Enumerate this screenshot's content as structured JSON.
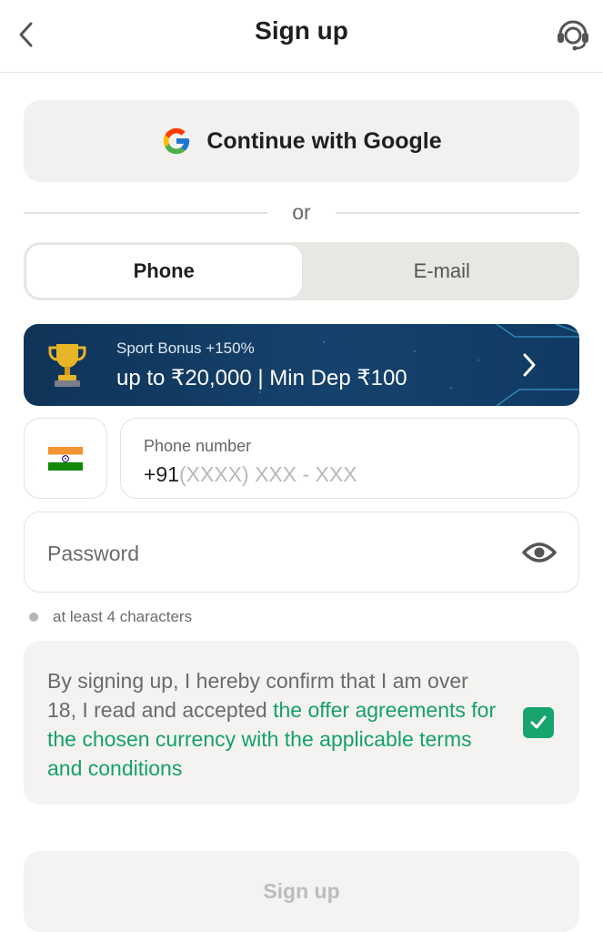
{
  "header": {
    "title": "Sign up",
    "back_icon": "chevron-left-icon",
    "support_icon": "headset-support-icon"
  },
  "google": {
    "label": "Continue with Google",
    "icon": "google-logo-icon"
  },
  "divider": {
    "text": "or"
  },
  "tabs": [
    {
      "label": "Phone",
      "active": true
    },
    {
      "label": "E-mail",
      "active": false
    }
  ],
  "bonus": {
    "title": "Sport Bonus +150%",
    "subtitle": "up to ₹20,000 | Min Dep ₹100",
    "icon": "trophy-icon",
    "arrow_icon": "chevron-right-icon"
  },
  "phone": {
    "flag_icon": "india-flag-icon",
    "label": "Phone number",
    "code": "+91",
    "placeholder": "(XXXX) XXX - XXX"
  },
  "password": {
    "placeholder": "Password",
    "toggle_icon": "eye-icon"
  },
  "hint": {
    "text": "at least 4 characters"
  },
  "terms": {
    "text": "By signing up, I hereby confirm that I am over 18, I read and accepted ",
    "link": "the offer agreements for the chosen currency with the applicable terms and conditions",
    "checked": true
  },
  "submit": {
    "label": "Sign up"
  },
  "colors": {
    "accent_green": "#17a56d",
    "banner_blue": "#15426c",
    "surface": "#f2f1ef"
  }
}
